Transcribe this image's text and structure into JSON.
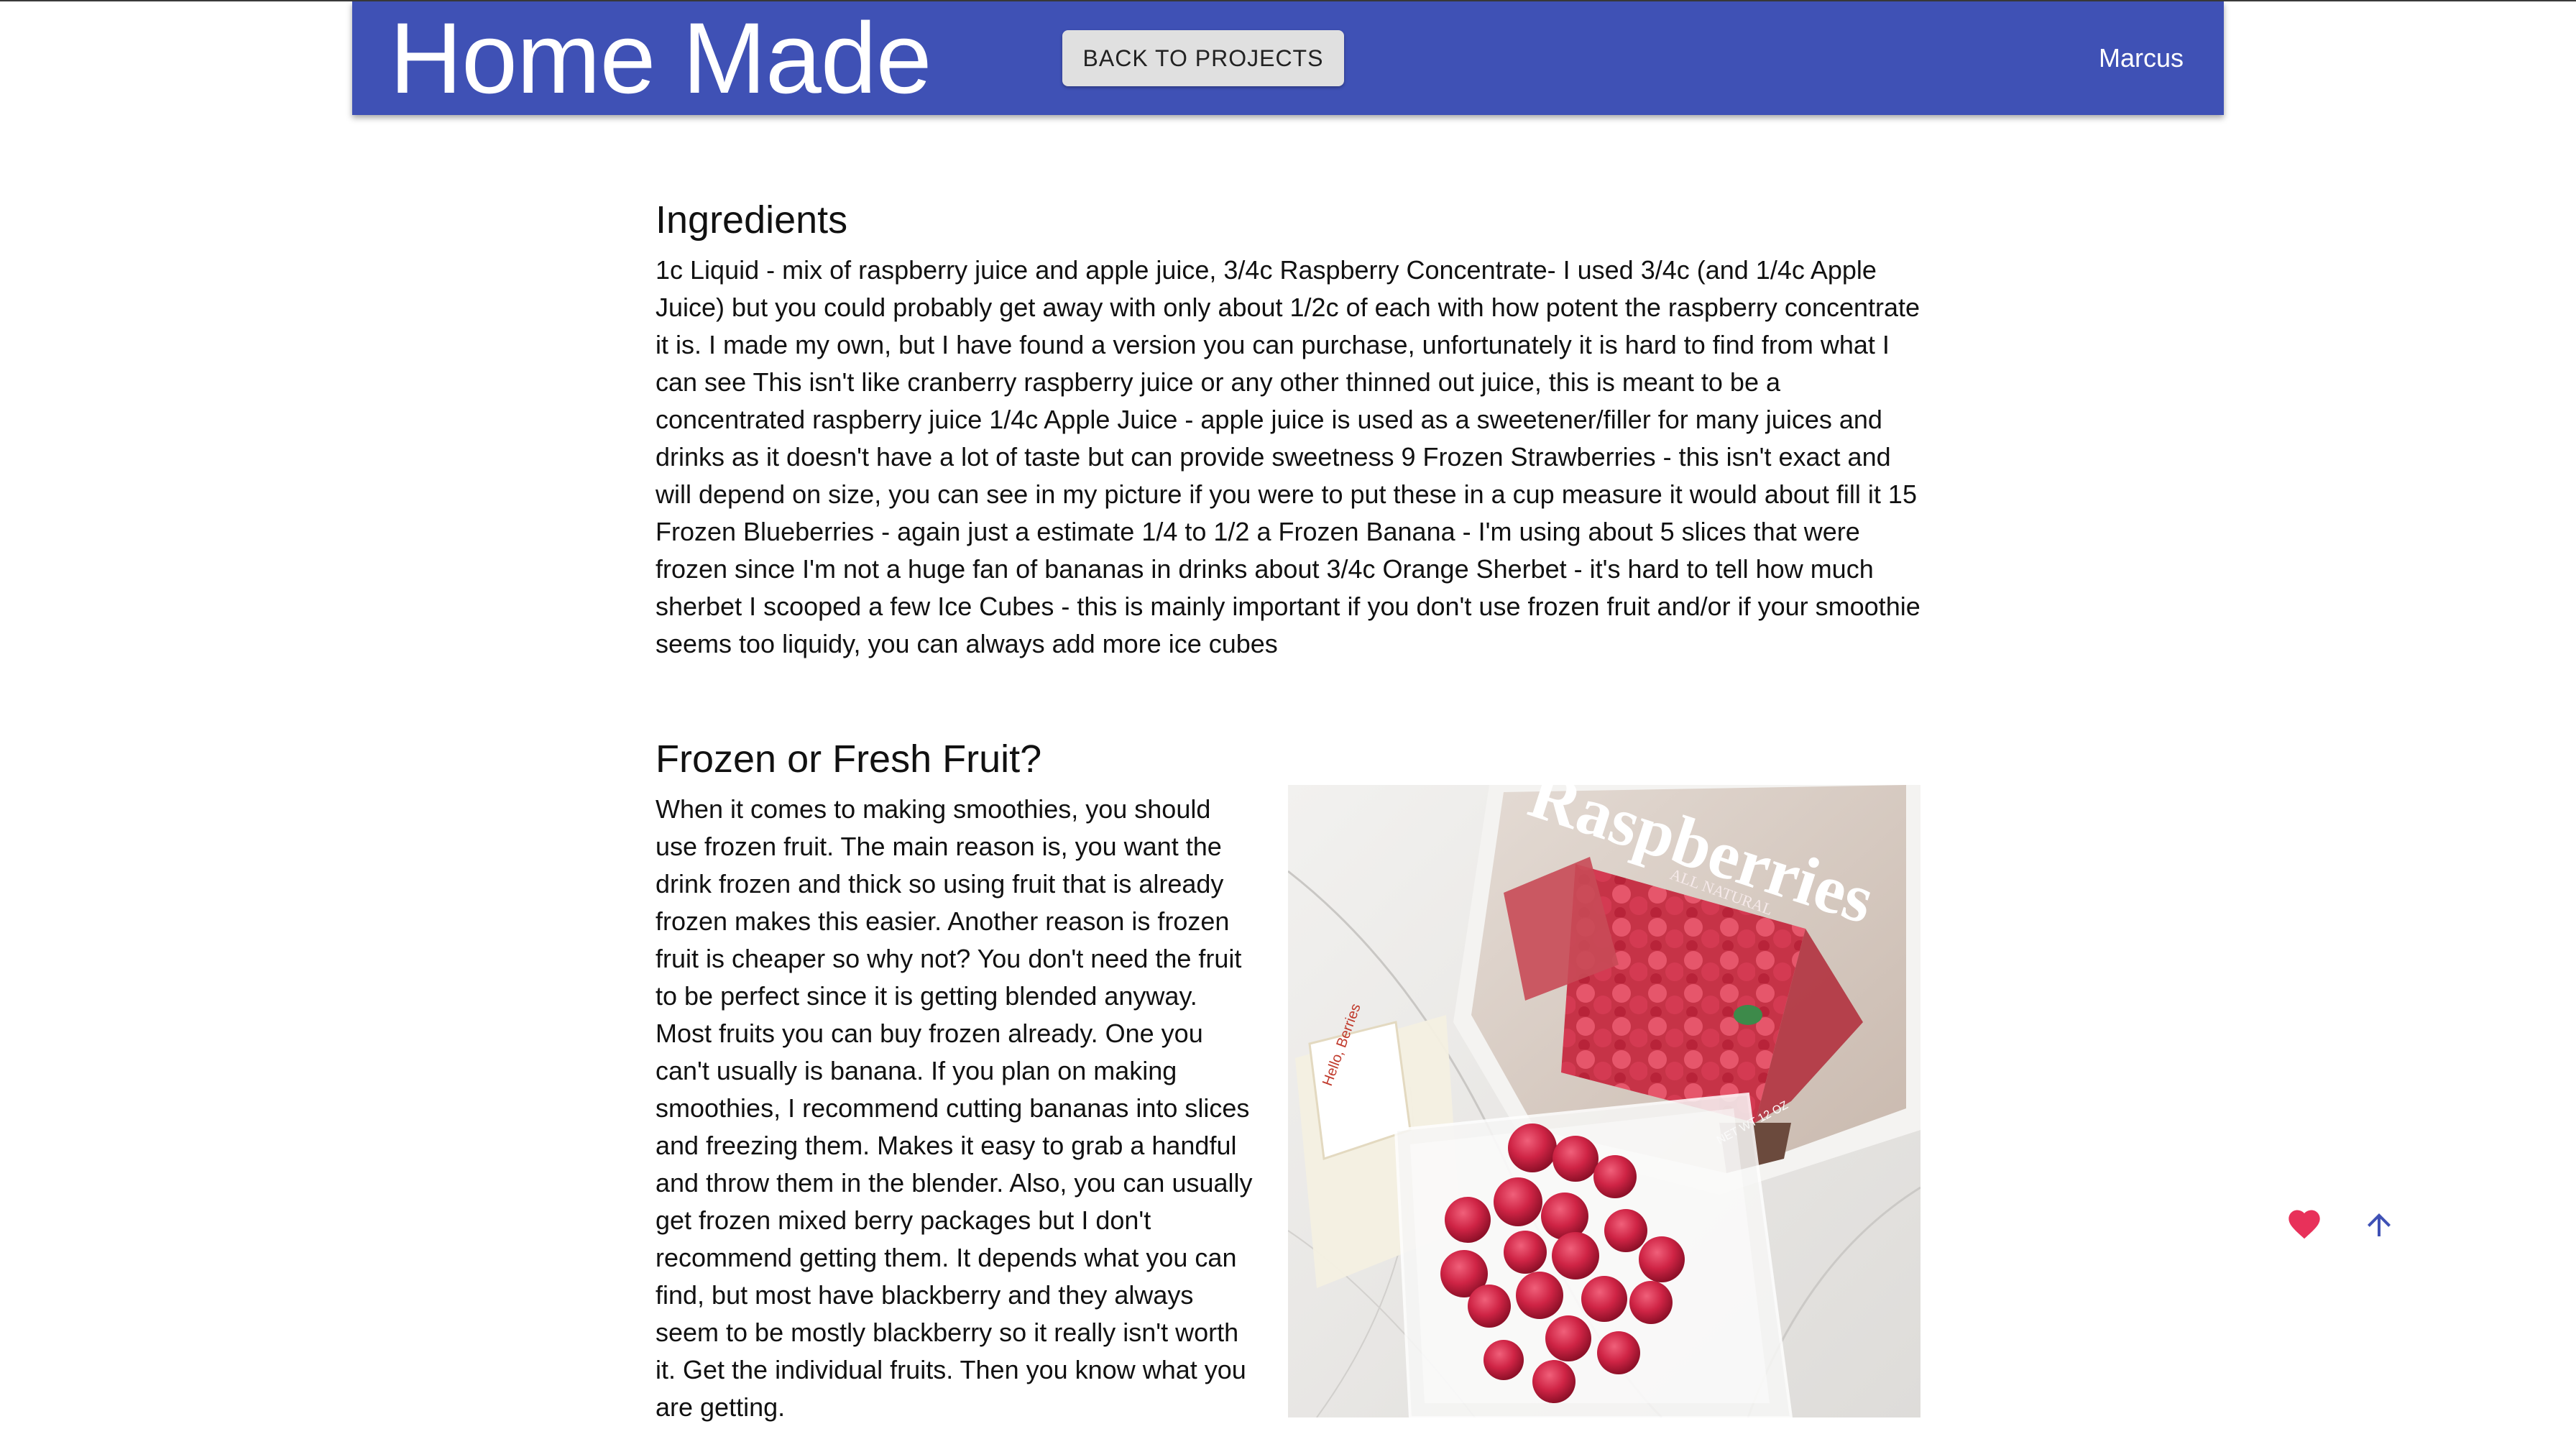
{
  "app_bar": {
    "title": "Home Made",
    "back_button_label": "BACK TO PROJECTS",
    "user_name": "Marcus",
    "color": "#3f51b5"
  },
  "ingredients": {
    "heading": "Ingredients",
    "body": "1c Liquid - mix of raspberry juice and apple juice, 3/4c Raspberry Concentrate- I used 3/4c (and 1/4c Apple Juice) but you could probably get away with only about 1/2c of each with how potent the raspberry concentrate it is. I made my own, but I have found a version you can purchase, unfortunately it is hard to find from what I can see This isn't like cranberry raspberry juice or any other thinned out juice, this is meant to be a concentrated raspberry juice 1/4c Apple Juice - apple juice is used as a sweetener/filler for many juices and drinks as it doesn't have a lot of taste but can provide sweetness 9 Frozen Strawberries - this isn't exact and will depend on size, you can see in my picture if you were to put these in a cup measure it would about fill it 15 Frozen Blueberries - again just a estimate 1/4 to 1/2 a Frozen Banana - I'm using about 5 slices that were frozen since I'm not a huge fan of bananas in drinks about 3/4c Orange Sherbet - it's hard to tell how much sherbet I scooped a few Ice Cubes - this is mainly important if you don't use frozen fruit and/or if your smoothie seems too liquidy, you can always add more ice cubes"
  },
  "fruit_section": {
    "heading": "Frozen or Fresh Fruit?",
    "body": "When it comes to making smoothies, you should use frozen fruit. The main reason is, you want the drink frozen and thick so using fruit that is already frozen makes this easier. Another reason is frozen fruit is cheaper so why not? You don't need the fruit to be perfect since it is getting blended anyway. Most fruits you can buy frozen already. One you can't usually is banana. If you plan on making smoothies, I recommend cutting bananas into slices and freezing them. Makes it easy to grab a handful and throw them in the blender. Also, you can usually get frozen mixed berry packages but I don't recommend getting them. It depends what you can find, but most have blackberry and they always seem to be mostly blackberry so it really isn't worth it. Get the individual fruits. Then you know what you are getting.",
    "photo": {
      "bag_brand_text": "Raspberries",
      "bag_sub_text": "ALL NATURAL",
      "bag_small_text": "NET WT 12 OZ",
      "container_label": "Hello, Berries"
    }
  },
  "floating_actions": {
    "like_icon": "heart-icon",
    "like_color": "#e8315a",
    "top_icon": "arrow-up-icon",
    "top_color": "#3f51b5"
  }
}
